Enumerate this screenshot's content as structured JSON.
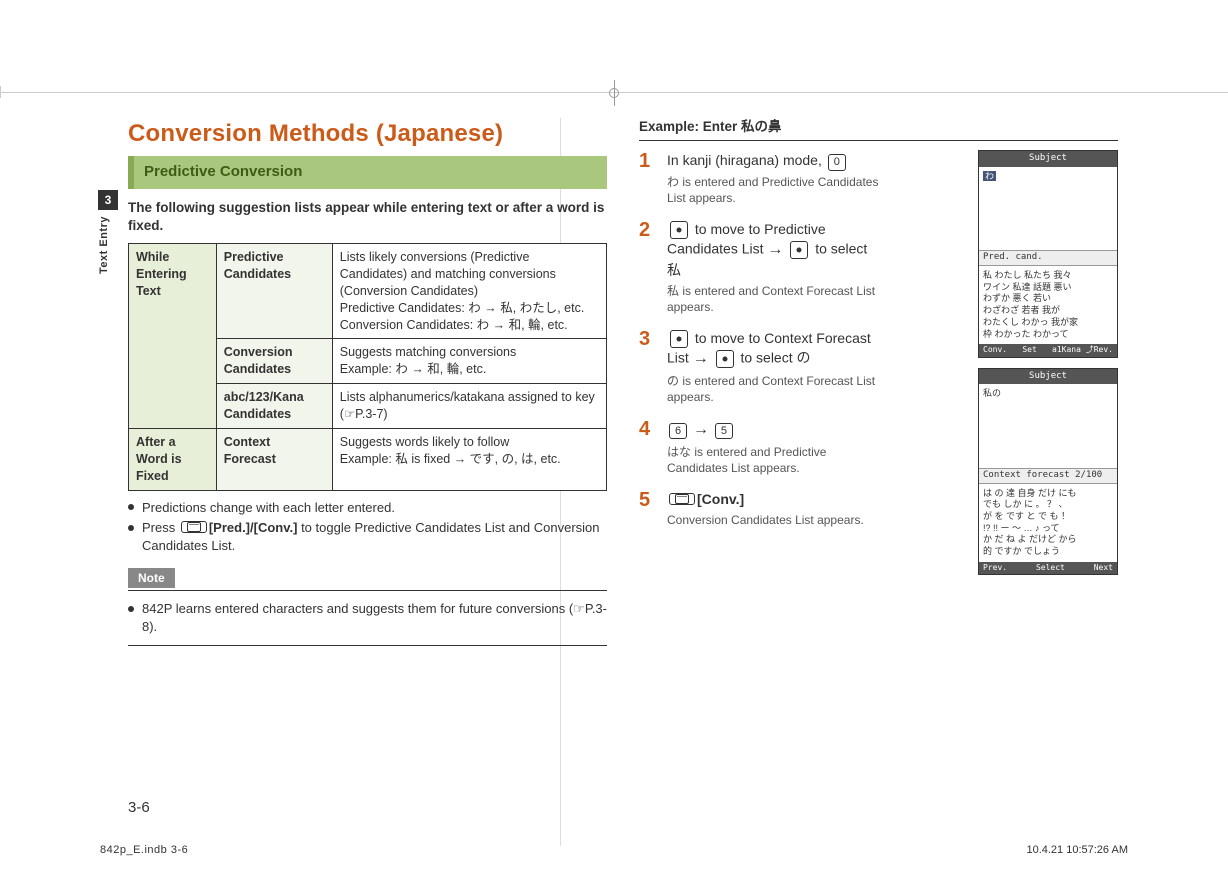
{
  "thumb": {
    "ch": "3",
    "label": "Text Entry"
  },
  "left": {
    "title": "Conversion Methods (Japanese)",
    "subhead": "Predictive Conversion",
    "intro": "The following suggestion lists appear while entering text or after a word is fixed.",
    "table": {
      "group1": "While Entering Text",
      "group2": "After a Word is Fixed",
      "rows": [
        {
          "label": "Predictive Candidates",
          "desc": "Lists likely conversions (Predictive Candidates) and matching conversions (Conversion Candidates)\nPredictive Candidates: わ → 私, わたし, etc.\nConversion Candidates: わ → 和, 輪, etc."
        },
        {
          "label": "Conversion Candidates",
          "desc": "Suggests matching conversions\nExample: わ → 和, 輪, etc."
        },
        {
          "label": "abc/123/Kana Candidates",
          "desc": "Lists alphanumerics/katakana assigned to key (☞P.3-7)"
        },
        {
          "label": "Context Forecast",
          "desc": "Suggests words likely to follow\nExample: 私 is fixed → です, の, は, etc."
        }
      ]
    },
    "bullets": [
      "Predictions change with each letter entered."
    ],
    "bullets_press": {
      "a": "Press ",
      "b": "[Pred.]/[Conv.]",
      "c": " to toggle Predictive Candidates List and Conversion Candidates List."
    },
    "note": {
      "label": "Note",
      "text": "842P learns entered characters and suggests them for future conversions (☞P.3-8)."
    }
  },
  "right": {
    "example_h": "Example: Enter 私の鼻",
    "steps": [
      {
        "n": "1",
        "main_a": "In kanji (hiragana) mode, ",
        "key": "0",
        "sub": "わ is entered and Predictive Candidates List appears."
      },
      {
        "n": "2",
        "main_a": " to move to Predictive Candidates List ",
        "main_b": " to select 私",
        "sub": "私 is entered and Context Forecast List appears."
      },
      {
        "n": "3",
        "main_a": " to move to Context Forecast List ",
        "main_b": " to select の",
        "sub": "の is entered and Context Forecast List appears."
      },
      {
        "n": "4",
        "key_a": "6",
        "key_b": "5",
        "sub": "はな is entered and Predictive Candidates List appears."
      },
      {
        "n": "5",
        "main": "[Conv.]",
        "sub": "Conversion Candidates List appears."
      }
    ]
  },
  "shots": {
    "s1": {
      "title": "Subject",
      "sel": "わ",
      "list_label": "Pred. cand.",
      "cands": "私 わたし 私たち 我々\nワイン 私達 話題 悪い\nわずか 悪く 若い\nわざわざ 若者 我が\nわたくし わかっ 我が家\n枠 わかった わかって",
      "soft": [
        "Conv.",
        "Set",
        "a1Kana  ⤴Rev."
      ]
    },
    "s2": {
      "title": "Subject",
      "line": "私の",
      "list_label": "Context forecast     2/100",
      "cands": "は の 達 自身 だけ にも\nでも しか に 。 ？ 、\nが を です と で も ！\n!? !! ー ～ … ♪ って\nか だ ね よ だけど から\n的 ですか でしょう",
      "soft": [
        "Prev.",
        "Select",
        "Next"
      ]
    }
  },
  "footer": {
    "page": "3-6",
    "file": "842p_E.indb   3-6",
    "time": "10.4.21   10:57:26 AM"
  }
}
